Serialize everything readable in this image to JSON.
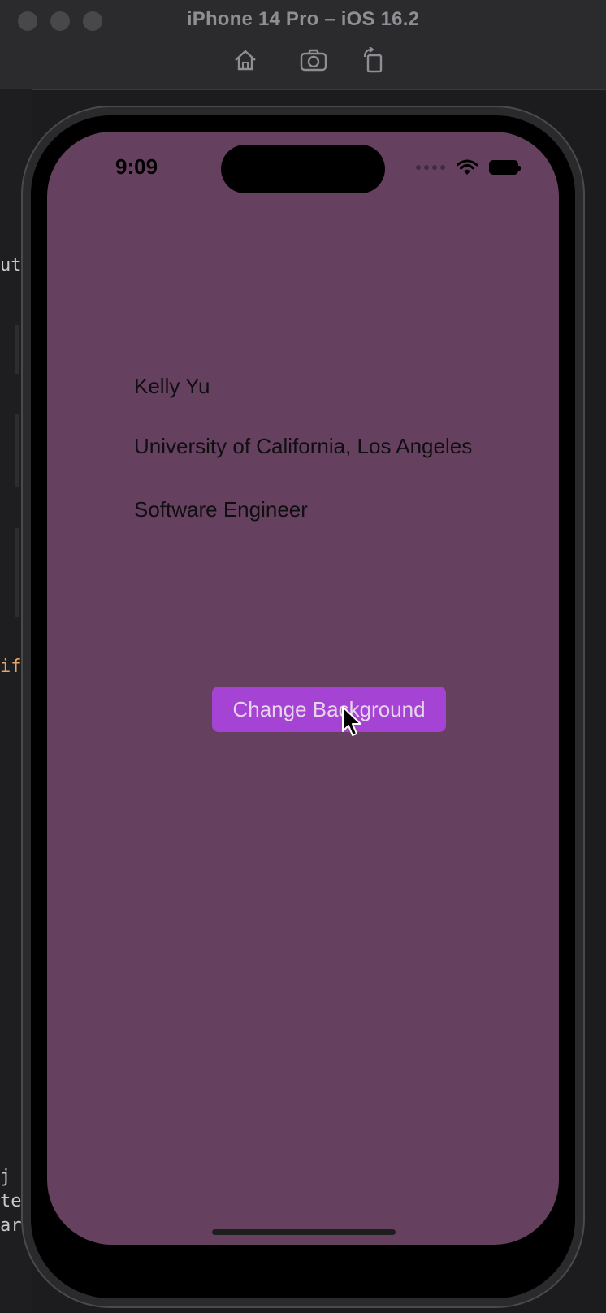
{
  "simulator": {
    "title": "iPhone 14 Pro – iOS 16.2",
    "toolbar": [
      {
        "icon": "home-icon"
      },
      {
        "icon": "screenshot-icon"
      },
      {
        "icon": "rotate-icon"
      }
    ]
  },
  "background_editor": {
    "fragments": [
      "ut",
      "if",
      "j",
      "te",
      "arkd"
    ]
  },
  "status_bar": {
    "time": "9:09",
    "icons": [
      "signal-dots-icon",
      "wifi-icon",
      "battery-icon"
    ]
  },
  "profile": {
    "name": "Kelly Yu",
    "school": "University of California, Los Angeles",
    "role": "Software Engineer"
  },
  "action_button": {
    "label": "Change Background"
  },
  "colors": {
    "screen_background": "#66415f",
    "button_background": "#a543d4",
    "button_text": "#e6d4ea"
  }
}
